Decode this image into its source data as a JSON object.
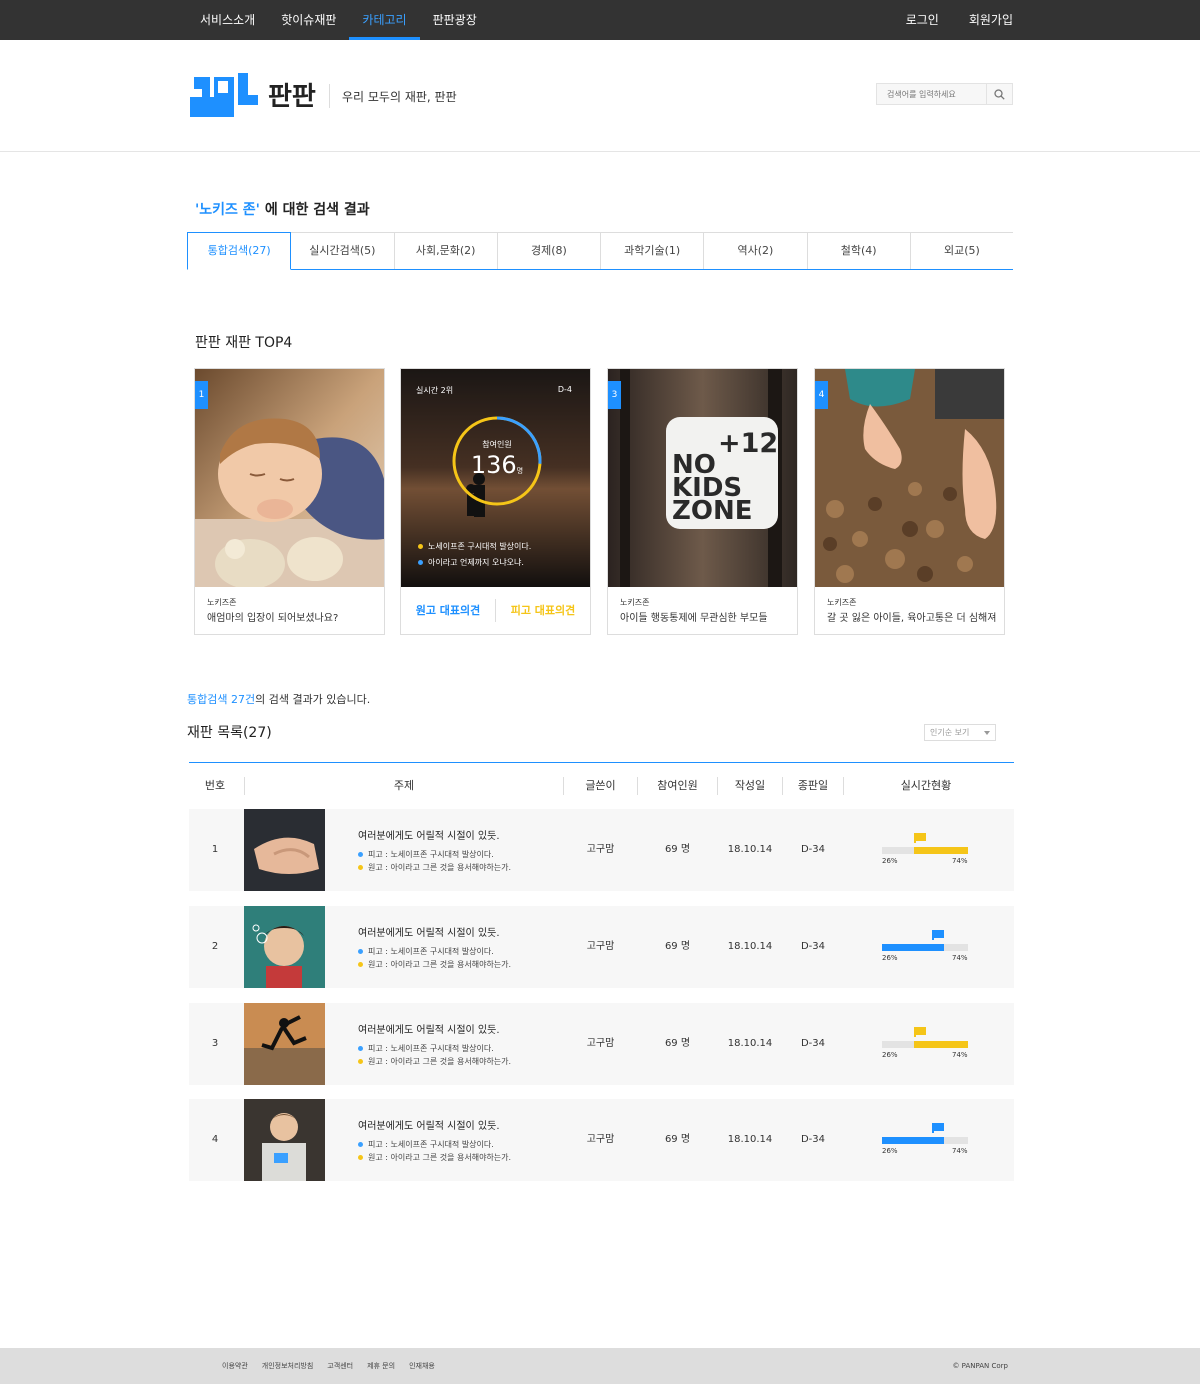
{
  "nav": {
    "menu": [
      "서비스소개",
      "핫이슈재판",
      "카테고리",
      "판판광장"
    ],
    "active_index": 2,
    "login": "로그인",
    "signup": "회원가입"
  },
  "header": {
    "logo_text": "판판",
    "slogan": "우리 모두의 재판, 판판",
    "search_placeholder": "검색어를 입력하세요"
  },
  "result": {
    "keyword": "'노키즈 존'",
    "suffix": " 에 대한 검색 결과"
  },
  "tabs": [
    {
      "label": "통합검색(27)",
      "active": true
    },
    {
      "label": "실시간검색(5)"
    },
    {
      "label": "사회,문화(2)"
    },
    {
      "label": "경제(8)"
    },
    {
      "label": "과학기술(1)"
    },
    {
      "label": "역사(2)"
    },
    {
      "label": "철학(4)"
    },
    {
      "label": "외교(5)"
    }
  ],
  "top4": {
    "title": "판판 재판 TOP4",
    "cards": [
      {
        "rank": "1",
        "category": "노키즈존",
        "subtitle": "애엄마의 입장이 되어보셨나요?"
      },
      {
        "live_label": "실시간 2위",
        "dday": "D-4",
        "participants_label": "참여인원",
        "participants": "136",
        "unit": "명",
        "line1": "노세이프존 구시대적 발상이다.",
        "line2": "아이라고 언제까지 오냐오냐.",
        "opinion_plaintiff": "원고 대표의견",
        "opinion_defendant": "피고 대표의견",
        "ring_ratio": 0.26
      },
      {
        "rank": "3",
        "category": "노키즈존",
        "subtitle": "아이들 행동통제에 무관심한 부모들",
        "sign_plus": "+12",
        "sign_text": [
          "NO",
          "KIDS",
          "ZONE"
        ]
      },
      {
        "rank": "4",
        "category": "노키즈존",
        "subtitle": "갈 곳 잃은 아이들, 육아고통은 더 심해져"
      }
    ]
  },
  "list": {
    "count_prefix": "통합검색 27건",
    "count_suffix": "의 검색 결과가 있습니다.",
    "title": "재판 목록(27)",
    "sort": "인기순 보기",
    "headers": [
      "번호",
      "주제",
      "글쓴이",
      "참여인원",
      "작성일",
      "종판일",
      "실시간현황"
    ],
    "rows": [
      {
        "no": "1",
        "subject": "여러분에게도 어릴적 시절이 있듯.",
        "defendant": "피고 : 노세이프존 구시대적 발상이다.",
        "plaintiff": "원고 : 아이라고 그른 것을 용서해야하는가.",
        "author": "고구맘",
        "participants": "69 명",
        "date": "18.10.14",
        "end": "D-34",
        "left_pct": "26%",
        "right_pct": "74%",
        "leader": "plaintiff",
        "split": 0.37
      },
      {
        "no": "2",
        "subject": "여러분에게도 어릴적 시절이 있듯.",
        "defendant": "피고 : 노세이프존 구시대적 발상이다.",
        "plaintiff": "원고 : 아이라고 그른 것을 용서해야하는가.",
        "author": "고구맘",
        "participants": "69 명",
        "date": "18.10.14",
        "end": "D-34",
        "left_pct": "26%",
        "right_pct": "74%",
        "leader": "defendant",
        "split": 0.72
      },
      {
        "no": "3",
        "subject": "여러분에게도 어릴적 시절이 있듯.",
        "defendant": "피고 : 노세이프존 구시대적 발상이다.",
        "plaintiff": "원고 : 아이라고 그른 것을 용서해야하는가.",
        "author": "고구맘",
        "participants": "69 명",
        "date": "18.10.14",
        "end": "D-34",
        "left_pct": "26%",
        "right_pct": "74%",
        "leader": "plaintiff",
        "split": 0.37
      },
      {
        "no": "4",
        "subject": "여러분에게도 어릴적 시절이 있듯.",
        "defendant": "피고 : 노세이프존 구시대적 발상이다.",
        "plaintiff": "원고 : 아이라고 그른 것을 용서해야하는가.",
        "author": "고구맘",
        "participants": "69 명",
        "date": "18.10.14",
        "end": "D-34",
        "left_pct": "26%",
        "right_pct": "74%",
        "leader": "defendant",
        "split": 0.72
      }
    ]
  },
  "footer": {
    "links": [
      "이용약관",
      "개인정보처리방침",
      "고객센터",
      "제휴 문의",
      "인재채용"
    ],
    "copyright": "© PANPAN Corp"
  },
  "colors": {
    "accent": "#1e90ff",
    "yellow": "#f5c518",
    "nav_bg": "#333333",
    "footer_bg": "#dddddd"
  }
}
